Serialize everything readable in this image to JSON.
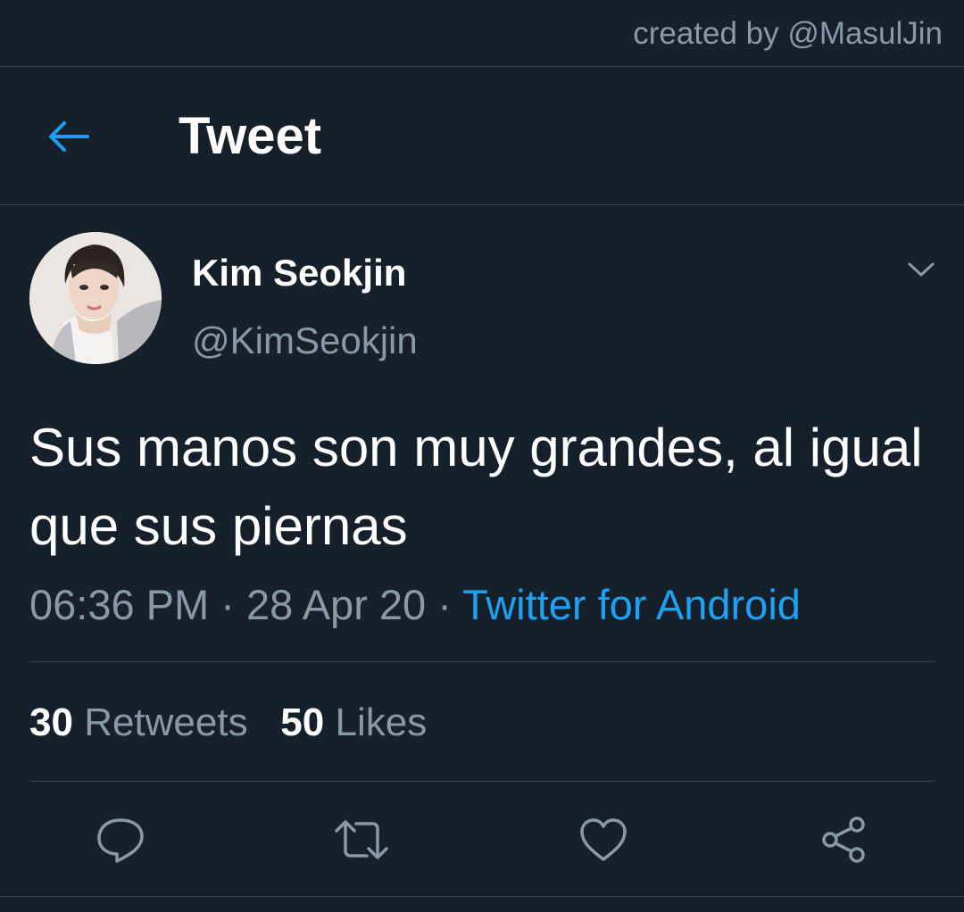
{
  "watermark": "created by @MasulJin",
  "header": {
    "title": "Tweet",
    "back_icon": "arrow-left-icon"
  },
  "author": {
    "name": "Kim Seokjin",
    "handle": "@KimSeokjin",
    "menu_icon": "chevron-down-icon"
  },
  "tweet": {
    "text": "Sus manos son muy grandes, al igual que sus piernas",
    "time": "06:36 PM",
    "date": "28 Apr 20",
    "separator": "·",
    "source": "Twitter for Android"
  },
  "stats": {
    "retweets_count": "30",
    "retweets_label": "Retweets",
    "likes_count": "50",
    "likes_label": "Likes"
  },
  "actions": [
    "reply-icon",
    "retweet-icon",
    "like-icon",
    "share-icon"
  ],
  "colors": {
    "background": "#15202b",
    "accent": "#1da1f2",
    "secondary_text": "#8899a6",
    "divider": "#38444d"
  }
}
